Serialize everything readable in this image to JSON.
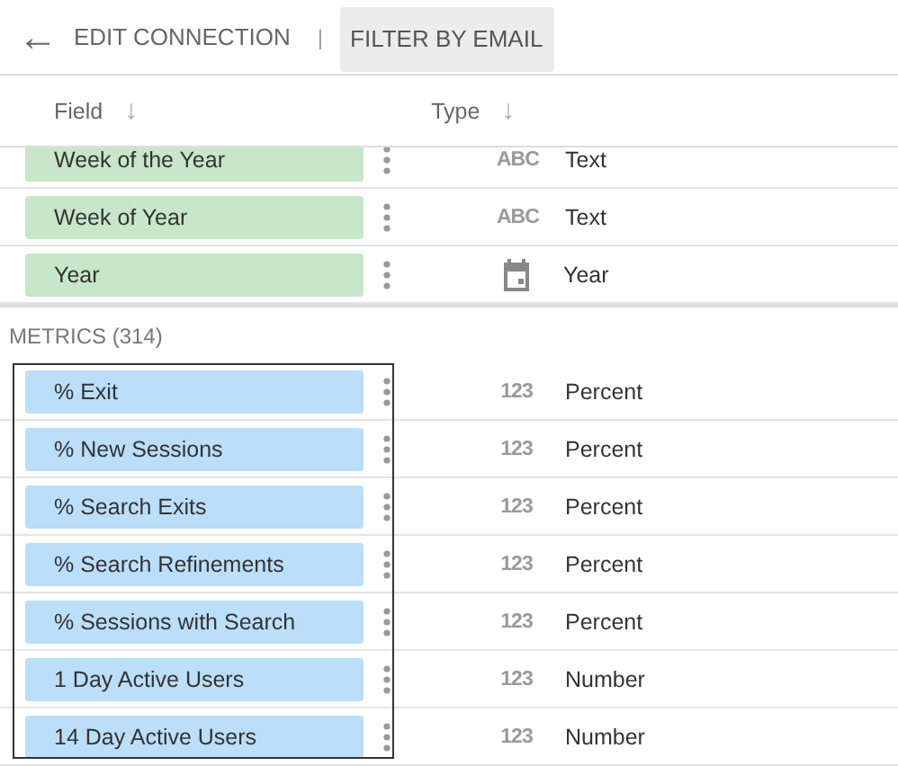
{
  "header": {
    "back": "←",
    "link": "EDIT CONNECTION",
    "separator": "|",
    "title": "FILTER BY EMAIL"
  },
  "columns": [
    {
      "label": "Field",
      "sort": "↓"
    },
    {
      "label": "Type",
      "sort": "↓"
    }
  ],
  "sections": [
    {
      "outlined": false,
      "rows": [
        {
          "kind": "dimension",
          "name": "Week of the Year",
          "type": {
            "kind": "text",
            "icon": "ABC",
            "label": "Text"
          }
        },
        {
          "kind": "dimension",
          "name": "Week of Year",
          "type": {
            "kind": "text",
            "icon": "ABC",
            "label": "Text"
          }
        },
        {
          "kind": "dimension",
          "name": "Year",
          "type": {
            "kind": "date",
            "label": "Year"
          }
        }
      ]
    },
    {
      "label": "METRICS (314)",
      "outlined": true,
      "rows": [
        {
          "kind": "metric",
          "name": "% Exit",
          "type": {
            "kind": "number",
            "icon": "123",
            "label": "Percent"
          }
        },
        {
          "kind": "metric",
          "name": "% New Sessions",
          "type": {
            "kind": "number",
            "icon": "123",
            "label": "Percent"
          }
        },
        {
          "kind": "metric",
          "name": "% Search Exits",
          "type": {
            "kind": "number",
            "icon": "123",
            "label": "Percent"
          }
        },
        {
          "kind": "metric",
          "name": "% Search Refinements",
          "type": {
            "kind": "number",
            "icon": "123",
            "label": "Percent"
          }
        },
        {
          "kind": "metric",
          "name": "% Sessions with Search",
          "type": {
            "kind": "number",
            "icon": "123",
            "label": "Percent"
          }
        },
        {
          "kind": "metric",
          "name": "1 Day Active Users",
          "type": {
            "kind": "number",
            "icon": "123",
            "label": "Number"
          }
        },
        {
          "kind": "metric",
          "name": "14 Day Active Users",
          "type": {
            "kind": "number",
            "icon": "123",
            "label": "Number"
          }
        }
      ]
    }
  ]
}
